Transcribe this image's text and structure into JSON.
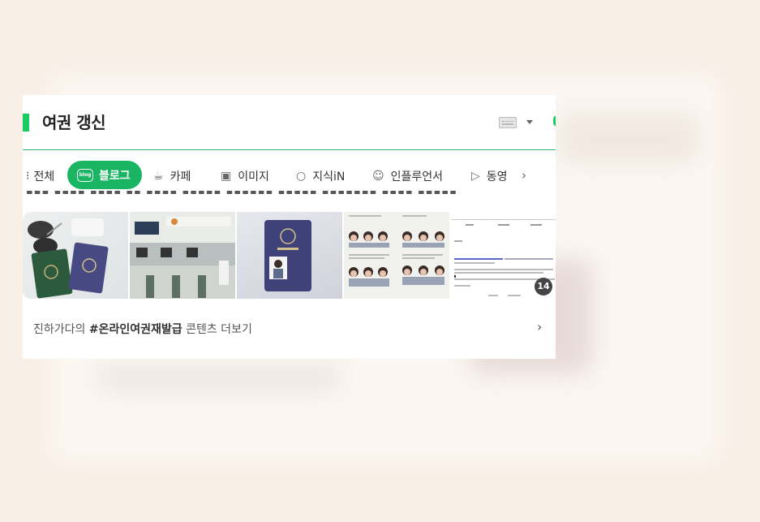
{
  "header": {
    "title": "여권 갱신"
  },
  "tabs": [
    {
      "label": "전체",
      "icon": "list-icon"
    },
    {
      "label": "블로그",
      "icon": "blog-icon",
      "active": true
    },
    {
      "label": "카페",
      "icon": "cafe-icon"
    },
    {
      "label": "이미지",
      "icon": "image-icon"
    },
    {
      "label": "지식iN",
      "icon": "kin-icon"
    },
    {
      "label": "인플루언서",
      "icon": "influencer-icon"
    },
    {
      "label": "동영",
      "icon": "video-icon"
    }
  ],
  "thumbnails": {
    "count_badge": "14"
  },
  "more": {
    "author": "진하가다의",
    "hashtag": "#온라인여권재발급",
    "suffix": "콘텐츠 더보기"
  },
  "colors": {
    "accent": "#19ce60",
    "active_tab": "#19b563",
    "background": "#f8efe6"
  }
}
